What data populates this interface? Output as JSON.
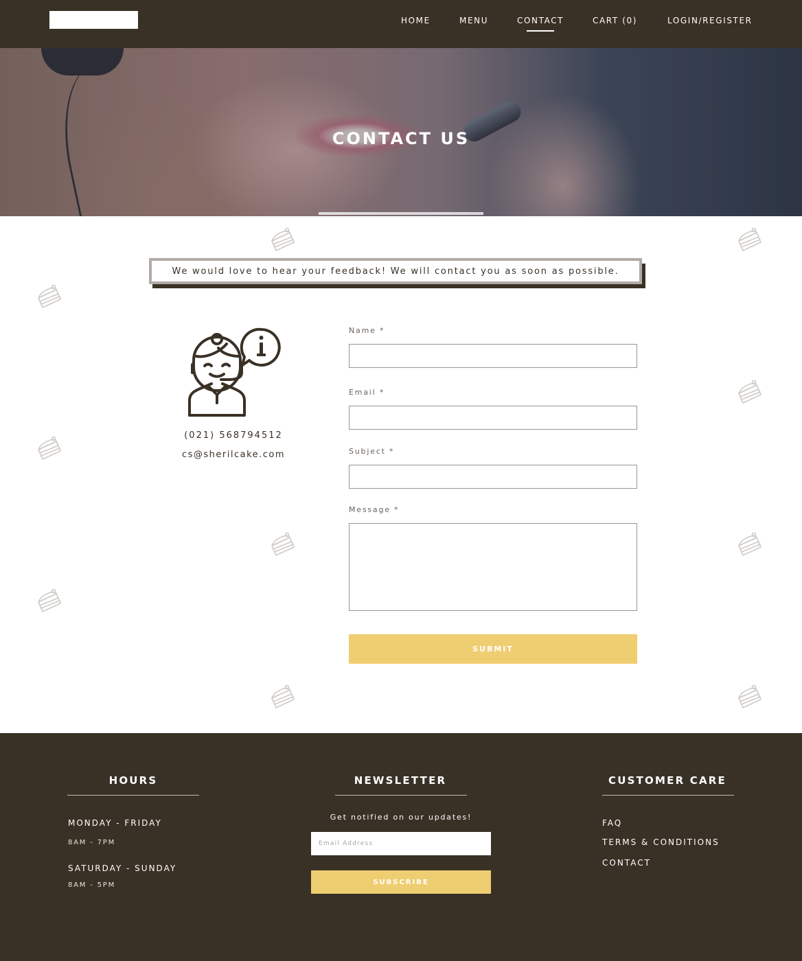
{
  "nav": {
    "home": "HOME",
    "menu": "MENU",
    "contact": "CONTACT",
    "cart": "CART (0)",
    "login": "LOGIN/REGISTER"
  },
  "hero": {
    "title": "CONTACT US"
  },
  "feedback": {
    "message": "We would love to hear your feedback! We will contact you as soon as possible."
  },
  "contact_info": {
    "phone": "(021) 568794512",
    "email": "cs@sherilcake.com"
  },
  "form": {
    "name_label": "Name *",
    "email_label": "Email *",
    "subject_label": "Subject *",
    "message_label": "Message *",
    "name_value": "",
    "email_value": "",
    "subject_value": "",
    "message_value": "",
    "submit_label": "SUBMIT"
  },
  "footer": {
    "hours": {
      "heading": "HOURS",
      "weekday_label": "MONDAY - FRIDAY",
      "weekday_time": "8AM - 7PM",
      "weekend_label": "SATURDAY - SUNDAY",
      "weekend_time": "8AM - 5PM"
    },
    "newsletter": {
      "heading": "NEWSLETTER",
      "note": "Get notified on our updates!",
      "placeholder": "Email Address",
      "subscribe_label": "SUBSCRIBE"
    },
    "customer_care": {
      "heading": "CUSTOMER CARE",
      "links": [
        "FAQ",
        "TERMS & CONDITIONS",
        "CONTACT"
      ]
    }
  },
  "colors": {
    "brand_dark": "#3a3126",
    "accent_yellow": "#efce72",
    "feedback_border": "#b2aaa6"
  },
  "icons": {
    "background_pattern": "cake-slice-icon",
    "agent": "customer-service-agent-icon",
    "info": "info-bubble-icon"
  }
}
